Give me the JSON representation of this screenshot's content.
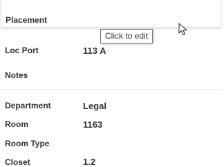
{
  "section": {
    "title": "Placement"
  },
  "tooltip": {
    "text": "Click to edit"
  },
  "fields": {
    "loc_port": {
      "label": "Loc Port",
      "value": "113 A"
    },
    "notes": {
      "label": "Notes",
      "value": ""
    },
    "department": {
      "label": "Department",
      "value": "Legal"
    },
    "room": {
      "label": "Room",
      "value": "1163"
    },
    "room_type": {
      "label": "Room Type",
      "value": ""
    },
    "closet": {
      "label": "Closet",
      "value": "1.2"
    }
  },
  "icons": {
    "cursor": "mouse-pointer-icon"
  }
}
